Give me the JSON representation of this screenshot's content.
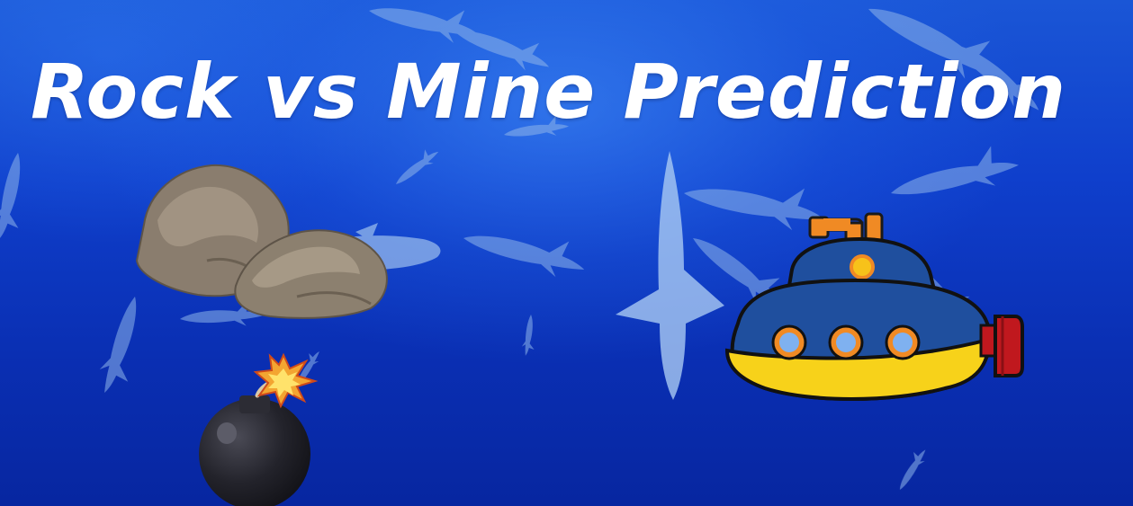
{
  "title": "Rock vs Mine Prediction",
  "colors": {
    "water_top": "#1a56d6",
    "water_bottom": "#0726a0",
    "title_text": "#ffffff",
    "rock": "#8a7d6e",
    "submarine_hull": "#1f4f9e",
    "submarine_belly": "#f7d21a",
    "submarine_propeller": "#c0181e",
    "bomb": "#1f1f26"
  },
  "icons": [
    "shark-icon",
    "rock-icon",
    "submarine-icon",
    "bomb-icon",
    "spark-icon"
  ]
}
